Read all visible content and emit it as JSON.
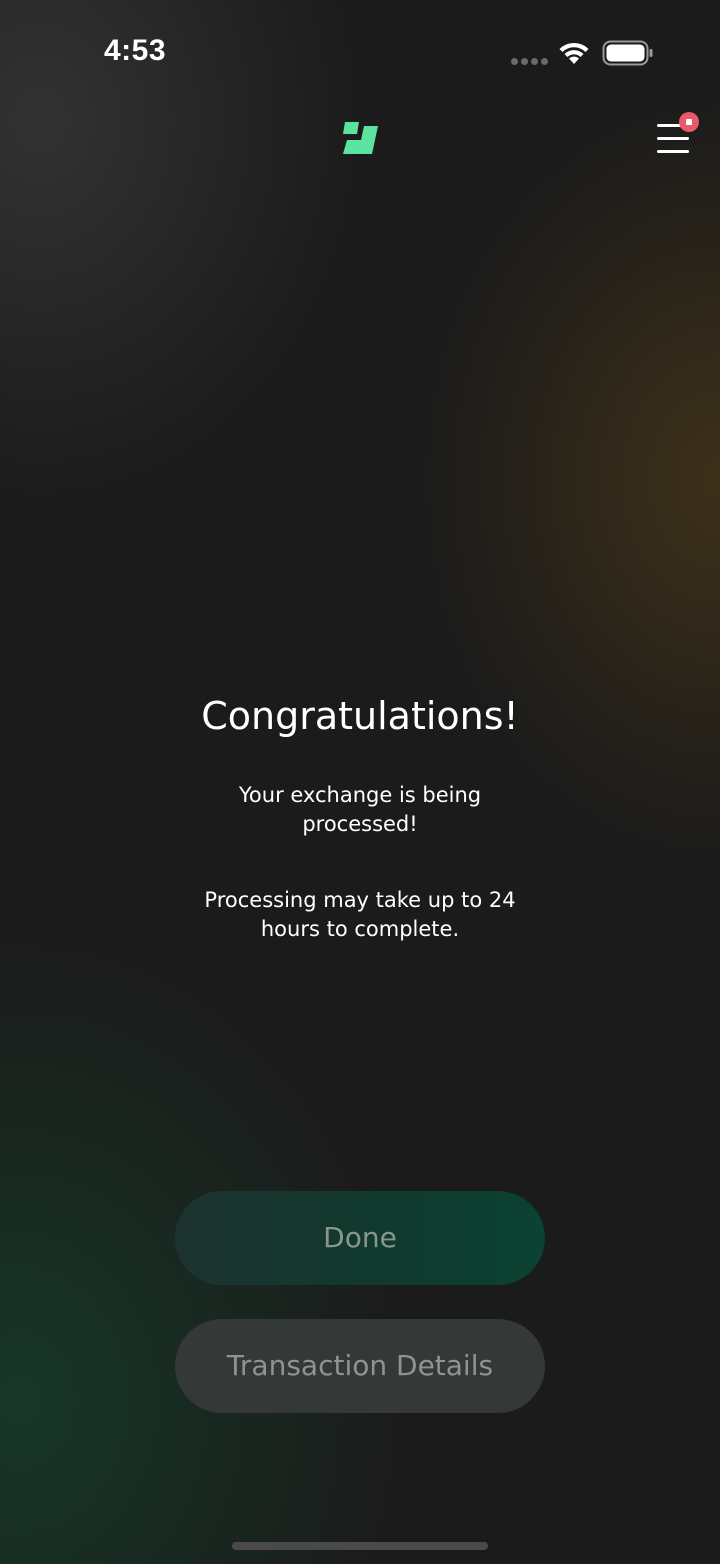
{
  "status_bar": {
    "time": "4:53",
    "icons": [
      "signal-dots-icon",
      "wifi-icon",
      "battery-icon"
    ]
  },
  "header": {
    "logo_icon": "brand-logo-icon",
    "menu_icon": "hamburger-menu-icon",
    "has_notification": true
  },
  "main": {
    "title": "Congratulations!",
    "message": "Your exchange is being processed!",
    "note": "Processing may take up to 24 hours to complete."
  },
  "actions": {
    "done_label": "Done",
    "details_label": "Transaction Details"
  },
  "colors": {
    "background": "#1b1b1b",
    "accent_green": "#5be3a0",
    "notification_red": "#e85a6a",
    "done_button": "#0f3a2d",
    "details_button": "#343836"
  }
}
